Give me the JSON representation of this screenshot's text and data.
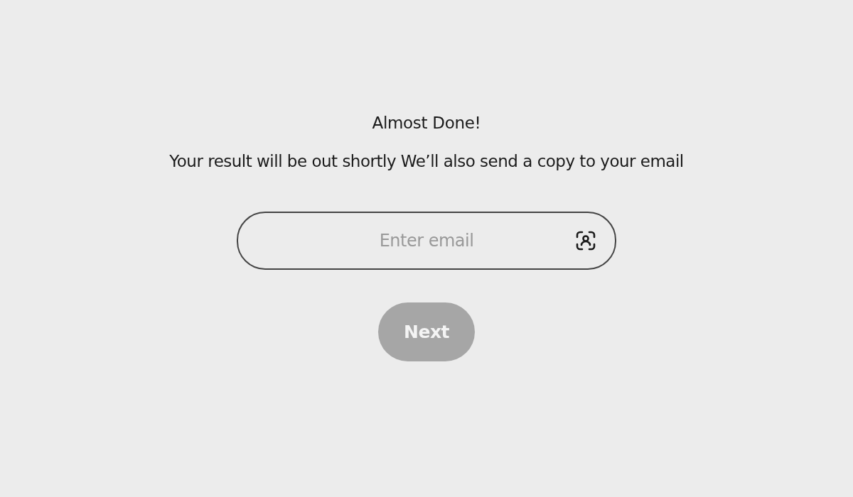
{
  "heading": "Almost Done!",
  "message": "Your result will be out shortly We’ll also send a copy to your email",
  "email_field": {
    "placeholder": "Enter email"
  },
  "next_button": {
    "label": "Next",
    "disabled": true
  }
}
